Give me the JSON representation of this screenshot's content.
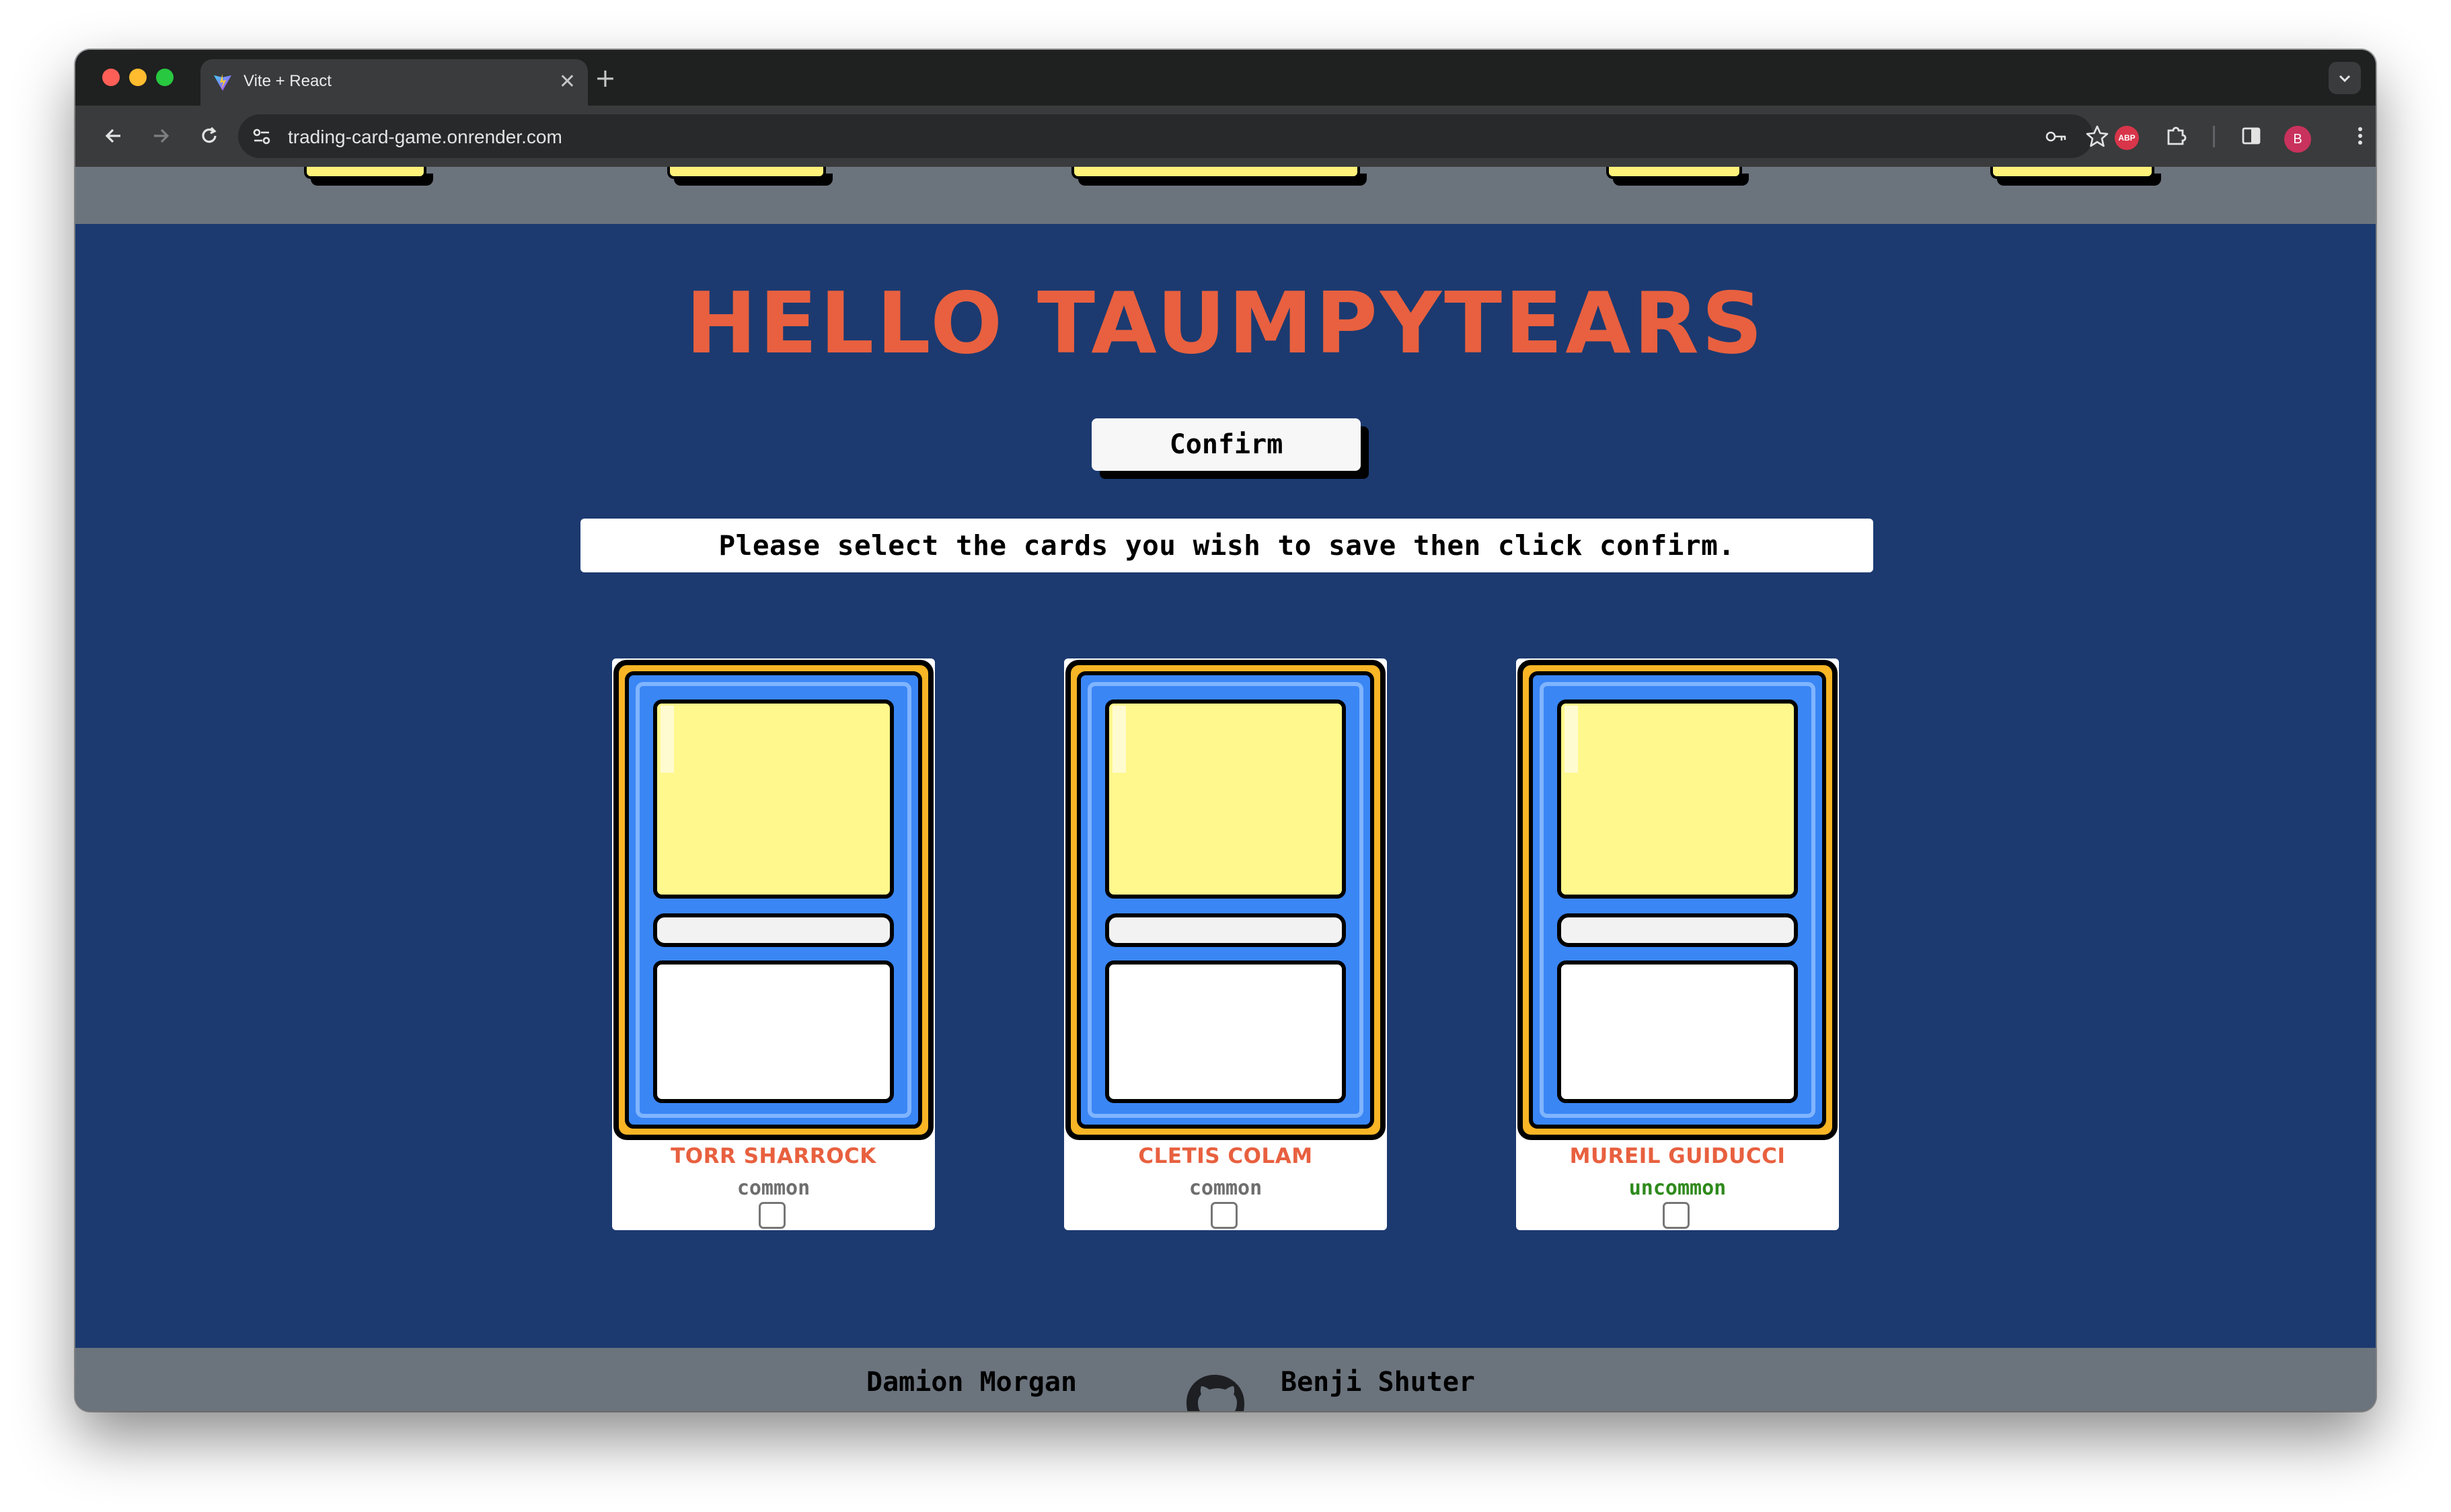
{
  "browser": {
    "tab_title": "Vite + React",
    "tab_close_icon": "close-icon",
    "new_tab_icon": "plus-icon",
    "url": "trading-card-game.onrender.com",
    "extensions": {
      "adblock_label": "ABP"
    },
    "profile_initial": "B"
  },
  "page": {
    "heading": "HELLO TAUMPYTEARS",
    "confirm_label": "Confirm",
    "instruction": "Please select the cards you wish to save then click confirm.",
    "cards": [
      {
        "name": "TORR SHARROCK",
        "rarity": "common",
        "rarity_color": "#6e6e6e",
        "selected": false
      },
      {
        "name": "CLETIS COLAM",
        "rarity": "common",
        "rarity_color": "#6e6e6e",
        "selected": false
      },
      {
        "name": "MUREIL GUIDUCCI",
        "rarity": "uncommon",
        "rarity_color": "#2f8a1c",
        "selected": false
      }
    ],
    "footer": {
      "left_name": "Damion Morgan",
      "right_name": "Benji Shuter",
      "icon": "github-icon"
    }
  },
  "colors": {
    "background": "#1c3a70",
    "heading": "#e8603f",
    "nav_band": "#6b737d",
    "card_art": "#fff88c",
    "card_frame_outer": "#f8b525",
    "card_frame_inner": "#3a86f5"
  }
}
